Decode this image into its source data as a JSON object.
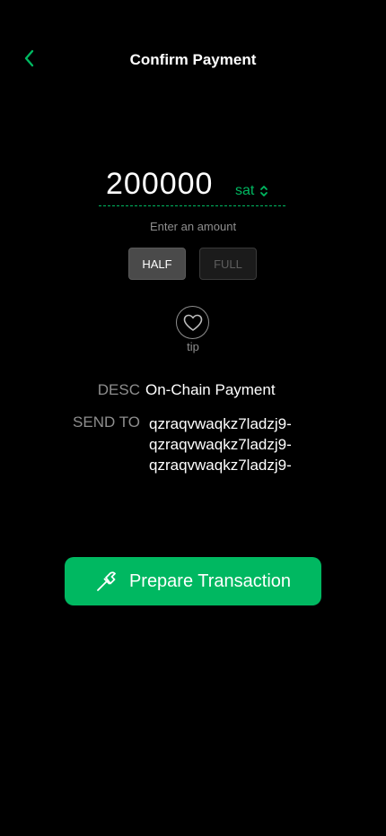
{
  "header": {
    "title": "Confirm Payment",
    "back_icon": "chevron-left-icon"
  },
  "amount": {
    "value": "200000",
    "unit": "sat",
    "hint": "Enter an amount"
  },
  "presets": {
    "half_label": "HALF",
    "full_label": "FULL"
  },
  "tip": {
    "label": "tip",
    "icon": "heart-icon"
  },
  "details": {
    "desc_label": "DESC",
    "desc_value": "On-Chain Payment",
    "send_to_label": "SEND TO",
    "send_to_lines": [
      "qzraqvwaqkz7ladzj9-",
      "qzraqvwaqkz7ladzj9-",
      "qzraqvwaqkz7ladzj9-"
    ]
  },
  "action": {
    "label": "Prepare Transaction",
    "icon": "hammer-icon"
  },
  "colors": {
    "accent": "#00b861",
    "background": "#000000",
    "muted_text": "#8e8e8e"
  }
}
